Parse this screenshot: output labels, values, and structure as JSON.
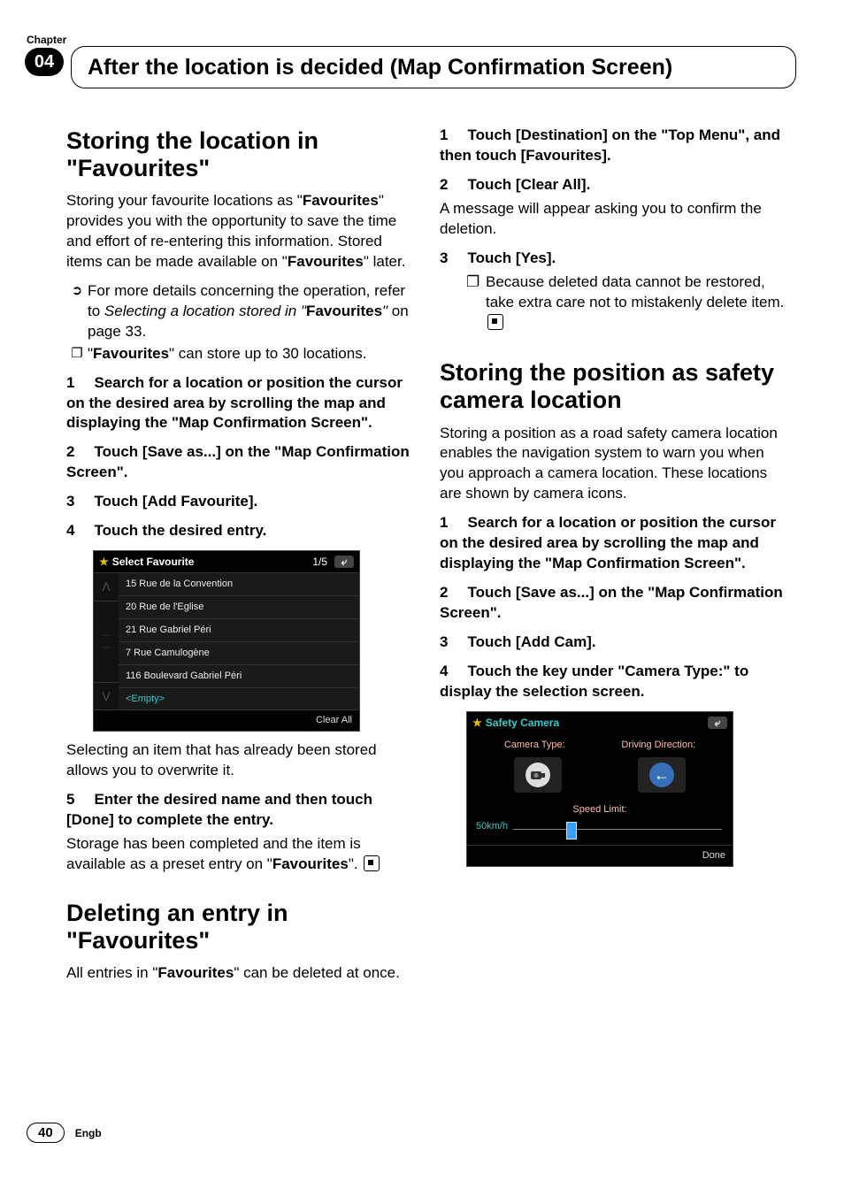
{
  "chapter": {
    "label": "Chapter",
    "number": "04"
  },
  "page_title": "After the location is decided (Map Confirmation Screen)",
  "footer": {
    "page": "40",
    "region": "Engb"
  },
  "left": {
    "h2_storing": "Storing the location in \"Favourites\"",
    "intro_a": "Storing your favourite locations as \"",
    "intro_bold1": "Favourites",
    "intro_b": "\" provides you with the opportunity to save the time and effort of re-entering this information. Stored items can be made available on \"",
    "intro_bold2": "Favourites",
    "intro_c": "\" later.",
    "bullets": {
      "refer_a": "For more details concerning the operation, refer to ",
      "refer_italic_a": "Selecting a location stored in ",
      "refer_italic_quote": "\"",
      "refer_bold": "Favourites",
      "refer_italic_b": "\"",
      "refer_c": " on page 33.",
      "limit_a": "\"",
      "limit_bold": "Favourites",
      "limit_b": "\" can store up to 30 locations."
    },
    "steps": {
      "s1": "Search for a location or position the cursor on the desired area by scrolling the map and displaying the \"Map Confirmation Screen\".",
      "s2": "Touch [Save as...] on the \"Map Confirmation Screen\".",
      "s3": "Touch [Add Favourite].",
      "s4": "Touch the desired entry."
    },
    "after_fig": "Selecting an item that has already been stored allows you to overwrite it.",
    "s5_label": "Enter the desired name and then touch [Done] to complete the entry.",
    "s5_body_a": "Storage has been completed and the item is available as a preset entry on \"",
    "s5_bold": "Favourites",
    "s5_body_b": "\".",
    "h2_deleting": "Deleting an entry in \"Favourites\"",
    "del_intro_a": "All entries in \"",
    "del_bold": "Favourites",
    "del_intro_b": "\" can be deleted at once."
  },
  "right": {
    "r1": "Touch [Destination] on the \"Top Menu\", and then touch [Favourites].",
    "r2_label": "Touch [Clear All].",
    "r2_body": "A message will appear asking you to confirm the deletion.",
    "r3_label": "Touch [Yes].",
    "r3_note": "Because deleted data cannot be restored, take extra care not to mistakenly delete item.",
    "h2_safety": "Storing the position as safety camera location",
    "safety_intro": "Storing a position as a road safety camera location enables the navigation system to warn you when you approach a camera location. These locations are shown by camera icons.",
    "ss1": "Search for a location or position the cursor on the desired area by scrolling the map and displaying the \"Map Confirmation Screen\".",
    "ss2": "Touch [Save as...] on the \"Map Confirmation Screen\".",
    "ss3": "Touch [Add Cam].",
    "ss4": "Touch the key under \"Camera Type:\" to display the selection screen."
  },
  "fig_sf": {
    "title": "Select Favourite",
    "page": "1/5",
    "rows": [
      "15 Rue de la Convention",
      "20 Rue de l'Eglise",
      "21 Rue Gabriel Péri",
      "7 Rue Camulogène",
      "116 Boulevard Gabriel Péri",
      "<Empty>"
    ],
    "clear": "Clear All"
  },
  "fig_sc": {
    "title": "Safety Camera",
    "cam_type": "Camera Type:",
    "dir": "Driving Direction:",
    "speed_label": "Speed Limit:",
    "speed_val": "50km/h",
    "done": "Done"
  }
}
